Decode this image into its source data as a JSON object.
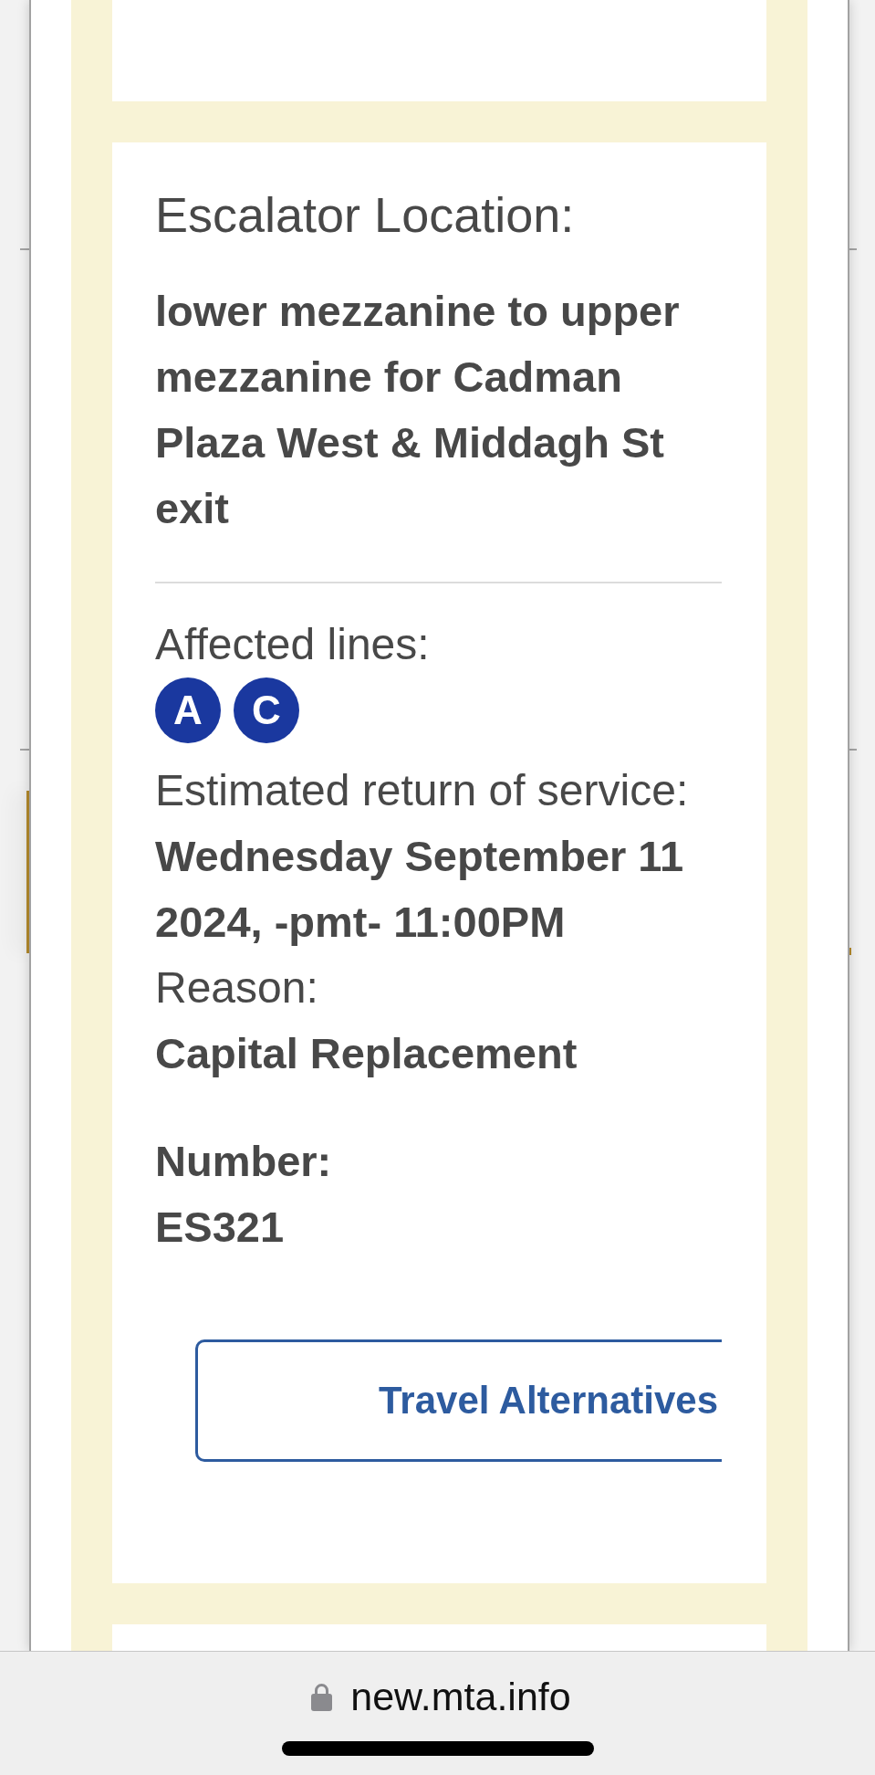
{
  "outage_card": {
    "location_label": "Escalator Location:",
    "location": "lower mezzanine to upper mezzanine for Cadman Plaza West & Middagh St exit",
    "affected_lines_label": "Affected lines:",
    "lines": [
      {
        "label": "A",
        "color": "#1a389f"
      },
      {
        "label": "C",
        "color": "#1a389f"
      }
    ],
    "return_label": "Estimated return of service:",
    "return_date": "Wednesday September 11 2024, -pmt- 11:00PM",
    "reason_label": "Reason:",
    "reason": "Capital Replacement",
    "number_label": "Number:",
    "number": "ES321",
    "travel_alternatives_button": "Travel Alternatives"
  },
  "browser_bar": {
    "url": "new.mta.info"
  }
}
